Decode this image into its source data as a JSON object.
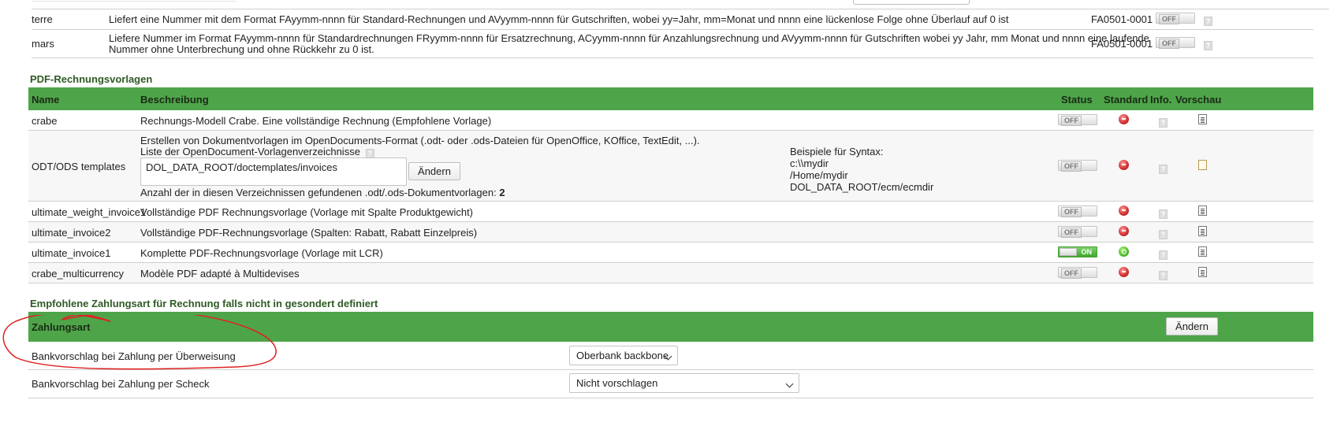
{
  "numbering": {
    "rows": [
      {
        "name": "terre",
        "description": "Liefert eine Nummer mit dem Format FAyymm-nnnn für Standard-Rechnungen und AVyymm-nnnn für Gutschriften, wobei yy=Jahr, mm=Monat und nnnn eine lückenlose Folge ohne Überlauf auf 0 ist",
        "example": "FA0501-0001",
        "status": "OFF"
      },
      {
        "name": "mars",
        "description_line1": "Liefere Nummer im Format FAyymm-nnnn für Standardrechnungen FRyymm-nnnn für Ersatzrechnung, ACyymm-nnnn für Anzahlungsrechnung und AVyymm-nnnn für Gutschriften wobei yy Jahr, mm Monat und nnnn eine laufende",
        "description_line2": "Nummer ohne Unterbrechung und ohne Rückkehr zu 0 ist.",
        "example": "FA0501-0001",
        "status": "OFF"
      }
    ]
  },
  "pdf_templates": {
    "section_title": "PDF-Rechnungsvorlagen",
    "columns": {
      "name": "Name",
      "description": "Beschreibung",
      "status": "Status",
      "default": "Standard",
      "info": "Info.",
      "preview": "Vorschau"
    },
    "rows": [
      {
        "name": "crabe",
        "description": "Rechnungs-Modell Crabe. Eine vollständige Rechnung (Empfohlene Vorlage)",
        "status": "OFF"
      },
      {
        "name": "ODT/ODS templates",
        "description_line1": "Erstellen von Dokumentvorlagen im OpenDocuments-Format (.odt- oder .ods-Dateien für OpenOffice, KOffice, TextEdit, ...).",
        "description_line2": "Liste der OpenDocument-Vorlagenverzeichnisse",
        "dir_value": "DOL_DATA_ROOT/doctemplates/invoices",
        "change_button": "Ändern",
        "count_label": "Anzahl der in diesen Verzeichnissen gefundenen .odt/.ods-Dokumentvorlagen:",
        "count_value": "2",
        "syntax_title": "Beispiele für Syntax:",
        "syntax_1": "c:\\\\mydir",
        "syntax_2": "/Home/mydir",
        "syntax_3": "DOL_DATA_ROOT/ecm/ecmdir",
        "status": "OFF"
      },
      {
        "name": "ultimate_weight_invoice1",
        "description": "Vollständige PDF Rechnungsvorlage (Vorlage mit Spalte Produktgewicht)",
        "status": "OFF"
      },
      {
        "name": "ultimate_invoice2",
        "description": "Vollständige PDF-Rechnungsvorlage (Spalten: Rabatt, Rabatt Einzelpreis)",
        "status": "OFF"
      },
      {
        "name": "ultimate_invoice1",
        "description": "Komplette PDF-Rechnungsvorlage (Vorlage mit LCR)",
        "status": "ON"
      },
      {
        "name": "crabe_multicurrency",
        "description": "Modèle PDF adapté à Multidevises",
        "status": "OFF"
      }
    ]
  },
  "payment": {
    "section_title": "Empfohlene Zahlungsart für Rechnung falls nicht in gesondert definiert",
    "header_label": "Zahlungsart",
    "change_button": "Ändern",
    "rows": [
      {
        "label": "Bankvorschlag bei Zahlung per Überweisung",
        "value": "Oberbank backbone"
      },
      {
        "label": "Bankvorschlag bei Zahlung per Scheck",
        "value": "Nicht vorschlagen"
      }
    ]
  },
  "colors": {
    "header_green": "#4ea549",
    "section_title": "#2e5a24",
    "annotation_red": "#e02020"
  }
}
